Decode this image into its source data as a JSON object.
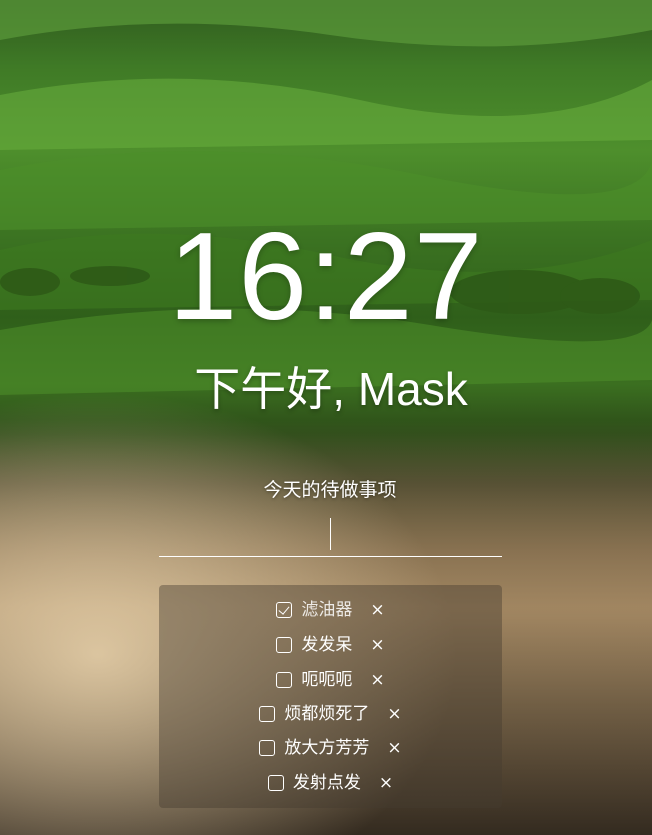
{
  "clock": {
    "time": "16:27"
  },
  "greeting": {
    "text": "下午好, Mask"
  },
  "todo": {
    "title": "今天的待做事项",
    "input_value": "",
    "items": [
      {
        "label": "滤油器",
        "checked": true,
        "delete_icon": "×"
      },
      {
        "label": "发发呆",
        "checked": false,
        "delete_icon": "×"
      },
      {
        "label": "呃呃呃",
        "checked": false,
        "delete_icon": "×"
      },
      {
        "label": "烦都烦死了",
        "checked": false,
        "delete_icon": "×"
      },
      {
        "label": "放大方芳芳",
        "checked": false,
        "delete_icon": "×"
      },
      {
        "label": "发射点发",
        "checked": false,
        "delete_icon": "×"
      }
    ]
  },
  "colors": {
    "text": "#ffffff",
    "panel": "rgba(70,60,48,0.42)"
  },
  "icons": {
    "checkbox_checked": "checkbox-checked-icon",
    "checkbox_unchecked": "checkbox-icon",
    "delete": "close-icon"
  }
}
